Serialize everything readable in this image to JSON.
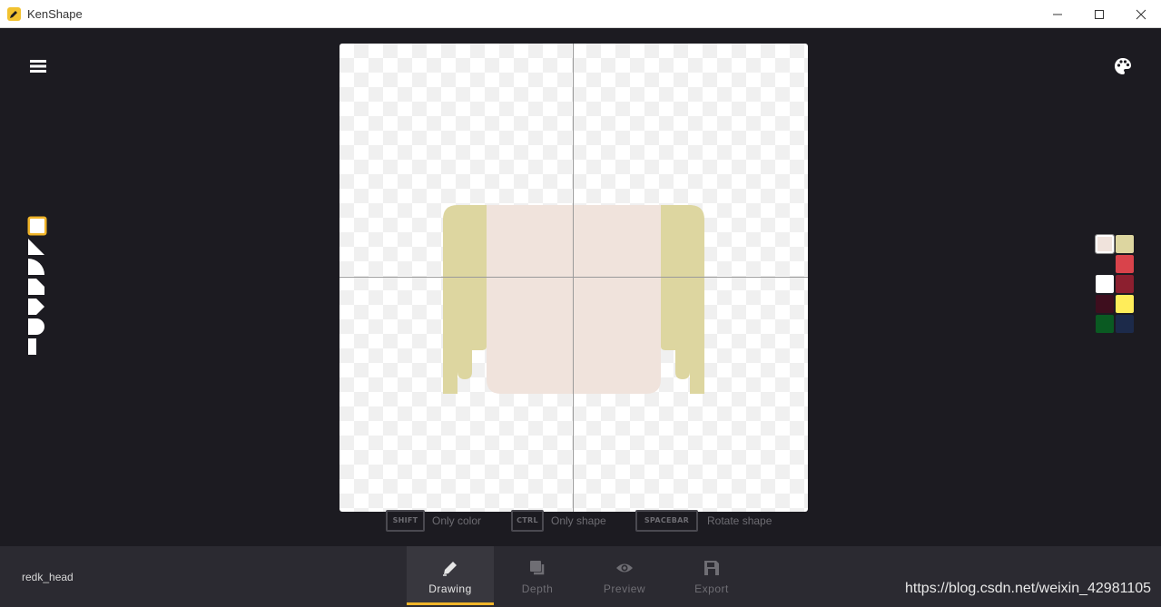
{
  "window": {
    "title": "KenShape",
    "minimize_icon": "minimize-icon",
    "maximize_icon": "maximize-icon",
    "close_icon": "close-icon"
  },
  "toolbar": {
    "menu_icon": "hamburger-menu-icon",
    "palette_icon": "palette-icon"
  },
  "shape_tools": [
    {
      "name": "square",
      "selected": true
    },
    {
      "name": "triangle",
      "selected": false
    },
    {
      "name": "quarter-circle",
      "selected": false
    },
    {
      "name": "cut-corner",
      "selected": false
    },
    {
      "name": "arrow",
      "selected": false
    },
    {
      "name": "half-circle",
      "selected": false
    },
    {
      "name": "half-bar",
      "selected": false
    }
  ],
  "canvas": {
    "face_color": "#f0e3dc",
    "hair_color": "#ddd6a0"
  },
  "hints": [
    {
      "key": "SHIFT",
      "text": "Only color"
    },
    {
      "key": "CTRL",
      "text": "Only shape"
    },
    {
      "key": "SPACEBAR",
      "text": "Rotate shape"
    }
  ],
  "colors": {
    "selected": "#f0e3dc",
    "swatches": [
      "#f0e3dc",
      "#ddd6a0",
      "#d9434b",
      "#ffffff",
      "#8c1f2f",
      "#3e0e1e",
      "#ffed5a",
      "#0a5a22",
      "#1c2a4a"
    ]
  },
  "bottom": {
    "filename": "redk_head",
    "tabs": [
      {
        "label": "Drawing",
        "icon": "pencil-icon",
        "active": true
      },
      {
        "label": "Depth",
        "icon": "layers-icon",
        "active": false
      },
      {
        "label": "Preview",
        "icon": "eye-icon",
        "active": false
      },
      {
        "label": "Export",
        "icon": "save-icon",
        "active": false
      }
    ],
    "watermark": "https://blog.csdn.net/weixin_42981105"
  }
}
